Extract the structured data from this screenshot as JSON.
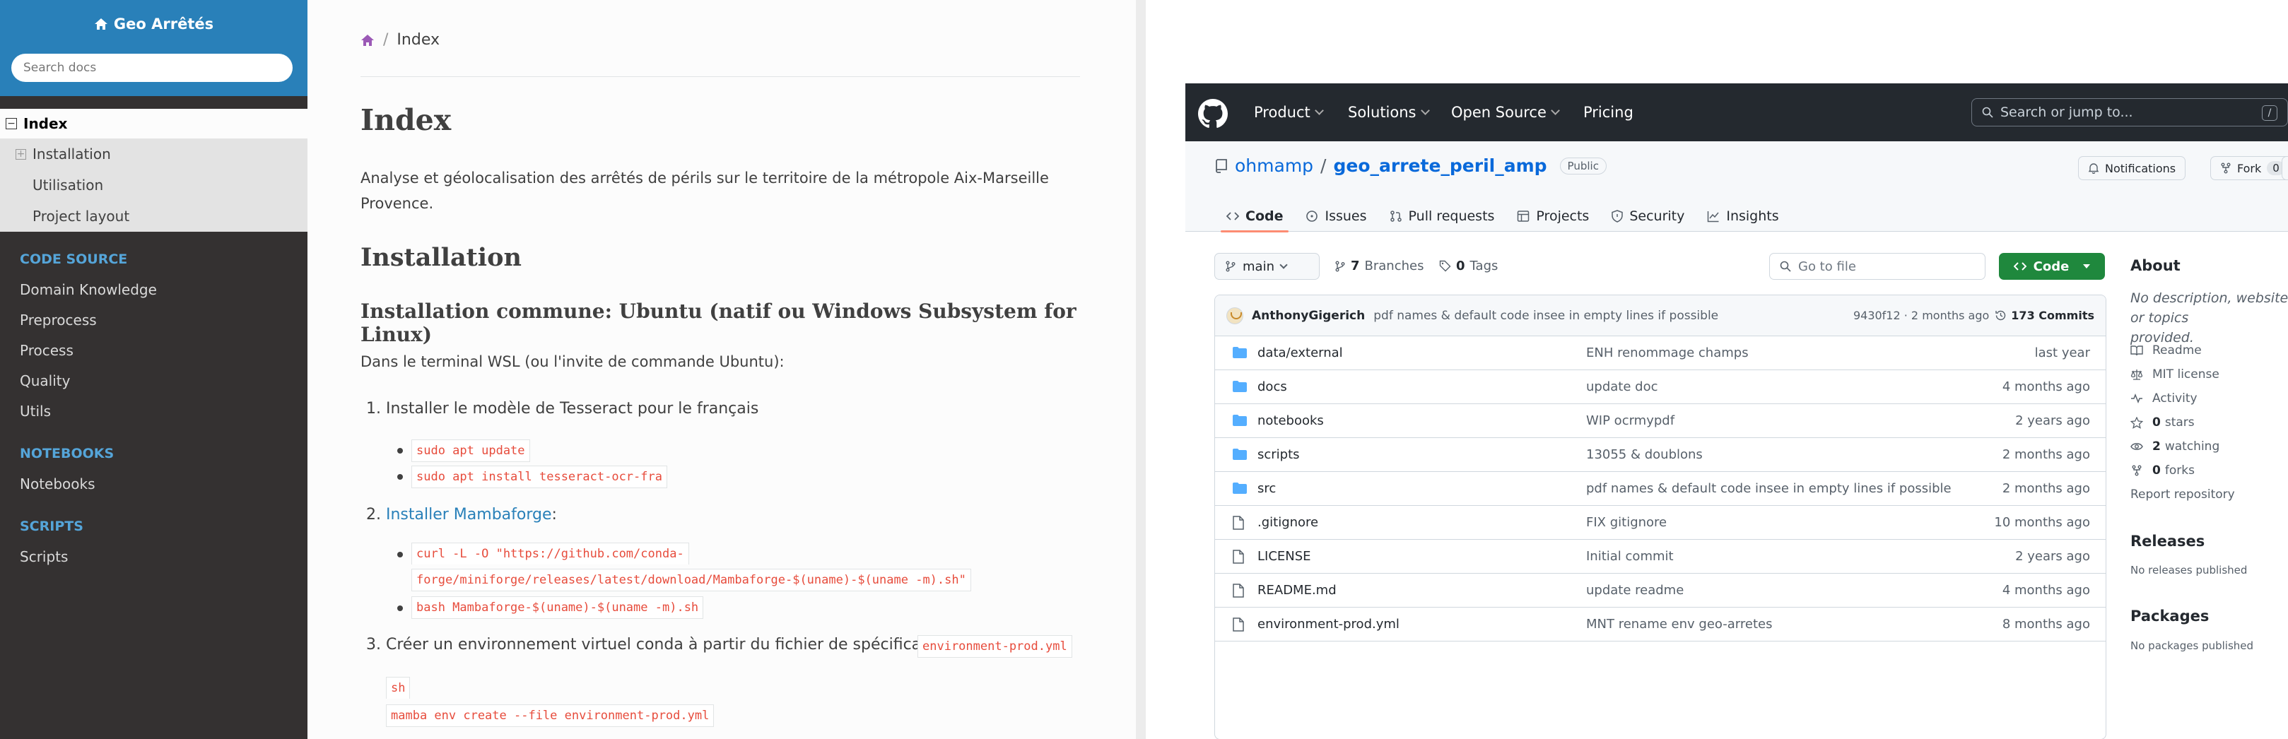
{
  "docs": {
    "site_title": "Geo Arrêtés",
    "search_placeholder": "Search docs",
    "toc": {
      "current": "Index",
      "sub": [
        "Installation",
        "Utilisation",
        "Project layout"
      ]
    },
    "sections": [
      {
        "caption": "CODE SOURCE",
        "links": [
          "Domain Knowledge",
          "Preprocess",
          "Process",
          "Quality",
          "Utils"
        ]
      },
      {
        "caption": "NOTEBOOKS",
        "links": [
          "Notebooks"
        ]
      },
      {
        "caption": "SCRIPTS",
        "links": [
          "Scripts"
        ]
      }
    ],
    "breadcrumb": {
      "sep": "/",
      "current": "Index"
    },
    "h1": "Index",
    "intro_line1": "Analyse et géolocalisation des arrêtés de périls sur le territoire de la métropole Aix-Marseille",
    "intro_line2": "Provence.",
    "h2_install": "Installation",
    "h3_common": "Installation commune: Ubuntu (natif ou Windows Subsystem for Linux)",
    "wsl_text": "Dans le terminal WSL (ou l'invite de commande Ubuntu):",
    "step1": "Installer le modèle de Tesseract pour le français",
    "step1_cmds": [
      "sudo apt update",
      "sudo apt install tesseract-ocr-fra"
    ],
    "step2_link": "Installer Mambaforge",
    "step2_colon": ":",
    "step2_cmd1_line1": "curl -L -O \"https://github.com/conda-",
    "step2_cmd1_line2": "forge/miniforge/releases/latest/download/Mambaforge-$(uname)-$(uname -m).sh\"",
    "step2_cmd2": "bash Mambaforge-$(uname)-$(uname -m).sh",
    "step3": "Créer un environnement virtuel conda à partir du fichier de spécifications",
    "step3_code": "environment-prod.yml",
    "step3_block_lang": "sh",
    "step3_block_cmd": "mamba env create --file environment-prod.yml",
    "numbers": [
      "1.",
      "2.",
      "3."
    ]
  },
  "github": {
    "nav": [
      "Product",
      "Solutions",
      "Open Source",
      "Pricing"
    ],
    "search_placeholder": "Search or jump to...",
    "search_shortcut": "/",
    "owner": "ohmamp",
    "slash": "/",
    "repo": "geo_arrete_peril_amp",
    "visibility": "Public",
    "notifications": "Notifications",
    "fork_label": "Fork",
    "fork_count": "0",
    "tabs": [
      "Code",
      "Issues",
      "Pull requests",
      "Projects",
      "Security",
      "Insights"
    ],
    "branch": "main",
    "branches_count": "7",
    "branches_label": "Branches",
    "tags_count": "0",
    "tags_label": "Tags",
    "goto_placeholder": "Go to file",
    "code_button": "Code",
    "commit": {
      "author": "AnthonyGigerich",
      "message": "pdf names & default code insee in empty lines if possible",
      "hash_age": "9430f12 · 2 months ago",
      "count": "173 Commits"
    },
    "files": [
      {
        "name": "data/external",
        "type": "dir",
        "msg": "ENH renommage champs",
        "age": "last year"
      },
      {
        "name": "docs",
        "type": "dir",
        "msg": "update doc",
        "age": "4 months ago"
      },
      {
        "name": "notebooks",
        "type": "dir",
        "msg": "WIP ocrmypdf",
        "age": "2 years ago"
      },
      {
        "name": "scripts",
        "type": "dir",
        "msg": "13055 & doublons",
        "age": "2 months ago"
      },
      {
        "name": "src",
        "type": "dir",
        "msg": "pdf names & default code insee in empty lines if possible",
        "age": "2 months ago"
      },
      {
        "name": ".gitignore",
        "type": "file",
        "msg": "FIX gitignore",
        "age": "10 months ago"
      },
      {
        "name": "LICENSE",
        "type": "file",
        "msg": "Initial commit",
        "age": "2 years ago"
      },
      {
        "name": "README.md",
        "type": "file",
        "msg": "update readme",
        "age": "4 months ago"
      },
      {
        "name": "environment-prod.yml",
        "type": "file",
        "msg": "MNT rename env geo-arretes",
        "age": "8 months ago"
      }
    ],
    "about": {
      "title": "About",
      "desc_line1": "No description, website, or topics",
      "desc_line2": "provided.",
      "readme": "Readme",
      "license": "MIT license",
      "activity": "Activity",
      "stars_n": "0",
      "stars_label": "stars",
      "watching_n": "2",
      "watching_label": "watching",
      "forks_n": "0",
      "forks_label": "forks",
      "report": "Report repository",
      "releases_title": "Releases",
      "releases_sub": "No releases published",
      "packages_title": "Packages",
      "packages_sub": "No packages published"
    }
  }
}
